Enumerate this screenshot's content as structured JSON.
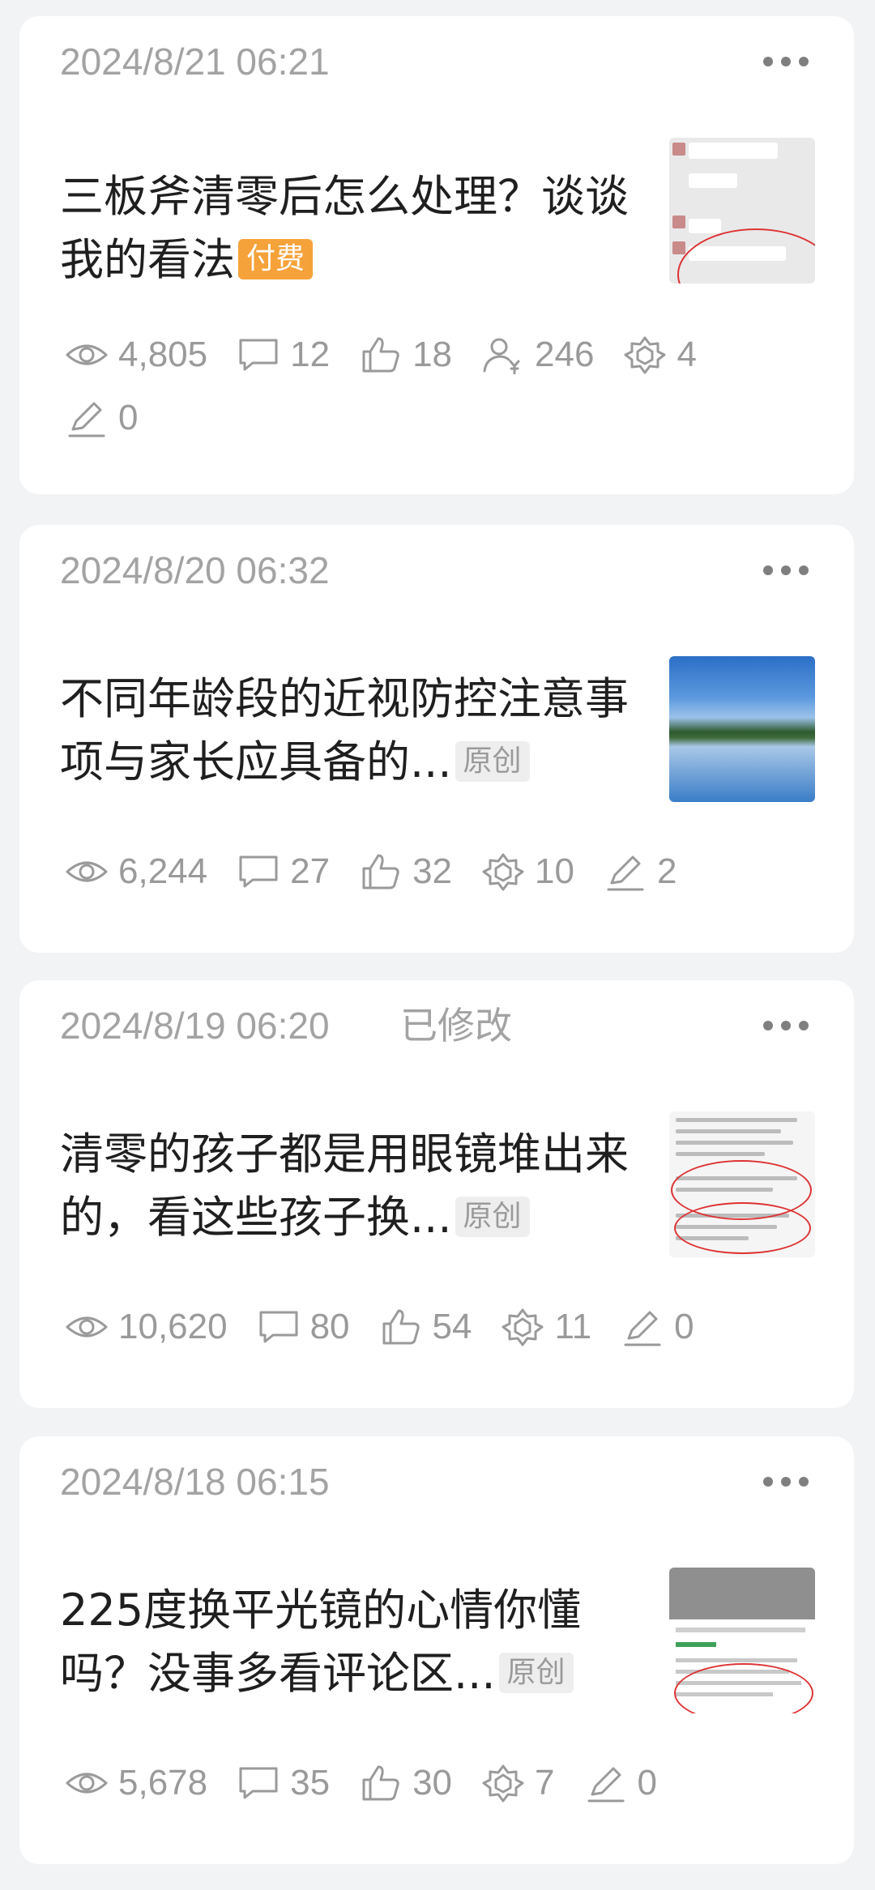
{
  "posts": [
    {
      "date": "2024/8/21 06:21",
      "modified": "",
      "title": "三板斧清零后怎么处理？谈谈我的看法",
      "tag": "付费",
      "tag_type": "paid",
      "thumbnail": "chat-screenshot",
      "stats": [
        {
          "icon": "eye-icon",
          "value": "4,805"
        },
        {
          "icon": "comment-icon",
          "value": "12"
        },
        {
          "icon": "thumb-up-icon",
          "value": "18"
        },
        {
          "icon": "paid-reader-icon",
          "value": "246"
        },
        {
          "icon": "share-icon",
          "value": "4"
        },
        {
          "icon": "pen-icon",
          "value": "0"
        }
      ]
    },
    {
      "date": "2024/8/20 06:32",
      "modified": "",
      "title": "不同年龄段的近视防控注意事项与家长应具备的...",
      "tag": "原创",
      "tag_type": "original",
      "thumbnail": "lake-photo",
      "stats": [
        {
          "icon": "eye-icon",
          "value": "6,244"
        },
        {
          "icon": "comment-icon",
          "value": "27"
        },
        {
          "icon": "thumb-up-icon",
          "value": "32"
        },
        {
          "icon": "share-icon",
          "value": "10"
        },
        {
          "icon": "pen-icon",
          "value": "2"
        }
      ]
    },
    {
      "date": "2024/8/19 06:20",
      "modified": "已修改",
      "title": "清零的孩子都是用眼镜堆出来的，看这些孩子换...",
      "tag": "原创",
      "tag_type": "original",
      "thumbnail": "comment-screenshot",
      "stats": [
        {
          "icon": "eye-icon",
          "value": "10,620"
        },
        {
          "icon": "comment-icon",
          "value": "80"
        },
        {
          "icon": "thumb-up-icon",
          "value": "54"
        },
        {
          "icon": "share-icon",
          "value": "11"
        },
        {
          "icon": "pen-icon",
          "value": "0"
        }
      ]
    },
    {
      "date": "2024/8/18 06:15",
      "modified": "",
      "title": "225度换平光镜的心情你懂吗？没事多看评论区...",
      "tag": "原创",
      "tag_type": "original",
      "thumbnail": "comment-screenshot",
      "stats": [
        {
          "icon": "eye-icon",
          "value": "5,678"
        },
        {
          "icon": "comment-icon",
          "value": "35"
        },
        {
          "icon": "thumb-up-icon",
          "value": "30"
        },
        {
          "icon": "share-icon",
          "value": "7"
        },
        {
          "icon": "pen-icon",
          "value": "0"
        }
      ]
    }
  ],
  "colors": {
    "page_bg": "#f2f3f5",
    "card_bg": "#ffffff",
    "muted_text": "#a3a3a3",
    "paid_tag": "#f6a23a",
    "original_tag_bg": "#eeeeee"
  }
}
